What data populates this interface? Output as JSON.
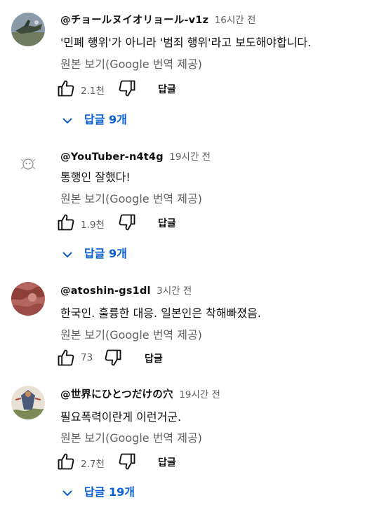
{
  "comments": [
    {
      "author": "@チョールヌイオリョール-v1z",
      "time": "16시간 전",
      "text": "'민폐 행위'가 아니라 '범죄 행위'라고 보도해야합니다.",
      "translate_label": "원본 보기(Google 번역 제공)",
      "likes": "2.1천",
      "reply_label": "답글",
      "replies_label": "답글 9개"
    },
    {
      "author": "@YouTuber-n4t4g",
      "time": "19시간 전",
      "text": "통행인 잘했다!",
      "translate_label": "원본 보기(Google 번역 제공)",
      "likes": "1.9천",
      "reply_label": "답글",
      "replies_label": "답글 9개"
    },
    {
      "author": "@atoshin-gs1dl",
      "time": "3시간 전",
      "text": "한국인. 훌륭한 대응. 일본인은 착해빠졌음.",
      "translate_label": "원본 보기(Google 번역 제공)",
      "likes": "73",
      "reply_label": "답글"
    },
    {
      "author": "@世界にひとつだけの穴",
      "time": "19시간 전",
      "text": "필요폭력이란게 이런거군.",
      "translate_label": "원본 보기(Google 번역 제공)",
      "likes": "2.7천",
      "reply_label": "답글",
      "replies_label": "답글 19개"
    }
  ],
  "icons": {
    "like": "thumbs-up-icon",
    "dislike": "thumbs-down-icon",
    "expand": "chevron-down-icon"
  },
  "colors": {
    "text": "#0f0f0f",
    "secondary": "#606060",
    "link": "#065fd4"
  }
}
